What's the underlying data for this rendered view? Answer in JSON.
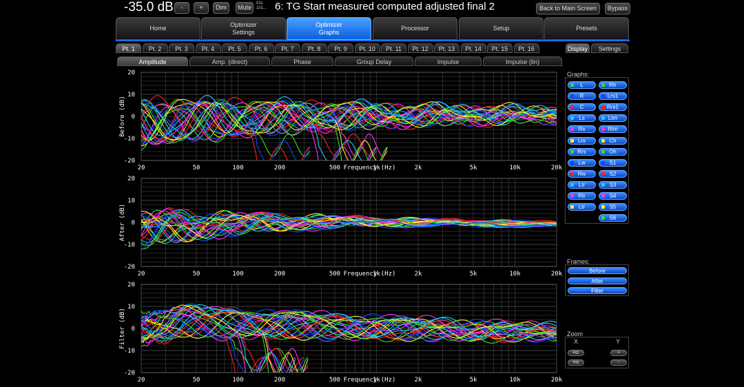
{
  "top": {
    "volume": "-35.0 dB",
    "minus": "-",
    "plus": "+",
    "dim": "Dim",
    "mute": "Mute",
    "format_line1": "011",
    "format_line2": "101...",
    "preset_title": "6: TG Start measured computed adjusted final 2",
    "back": "Back to Main Screen",
    "bypass": "Bypass"
  },
  "main_tabs": [
    {
      "l1": "Home",
      "l2": ""
    },
    {
      "l1": "Optimizer",
      "l2": "Settings"
    },
    {
      "l1": "Optimizer",
      "l2": "Graphs"
    },
    {
      "l1": "Processor",
      "l2": ""
    },
    {
      "l1": "Setup",
      "l2": ""
    },
    {
      "l1": "Presets",
      "l2": ""
    }
  ],
  "point_tabs": [
    "Pt. 1",
    "Pt. 2",
    "Pt. 3",
    "Pt. 4",
    "Pt. 5",
    "Pt. 6",
    "Pt. 7",
    "Pt. 8",
    "Pt. 9",
    "Pt. 10",
    "Pt. 11",
    "Pt. 12",
    "Pt. 13",
    "Pt. 14",
    "Pt. 15",
    "Pt. 16"
  ],
  "right_tabs": {
    "display": "Display",
    "settings": "Settings"
  },
  "graph_tabs": [
    "Amplitude",
    "Amp. (direct)",
    "Phase",
    "Group Delay",
    "Impulse",
    "Impulse (lin)"
  ],
  "sidebar": {
    "graphs_label": "Graphs:",
    "channels_left": [
      {
        "label": "L",
        "color": "#33dd33"
      },
      {
        "label": "R",
        "color": "#1144ff"
      },
      {
        "label": "C",
        "color": "#ff2222"
      },
      {
        "label": "Ls",
        "color": "#22ccff"
      },
      {
        "label": "Rs",
        "color": "#ff33ff"
      },
      {
        "label": "Lrs",
        "color": "#ffee22"
      },
      {
        "label": "Rrs",
        "color": "#33dd33"
      },
      {
        "label": "Lw",
        "color": "#1144ff"
      },
      {
        "label": "Rw",
        "color": "#ff2222"
      },
      {
        "label": "Ltr",
        "color": "#22ccff"
      },
      {
        "label": "Rtr",
        "color": "#ff33ff"
      },
      {
        "label": "Ltr",
        "color": "#ffee22"
      }
    ],
    "channels_right": [
      {
        "label": "Rtr",
        "color": "#33dd33"
      },
      {
        "label": "Lrs1",
        "color": "#1144ff"
      },
      {
        "label": "Rrs1",
        "color": "#ff2222"
      },
      {
        "label": "Ltm",
        "color": "#22ccff"
      },
      {
        "label": "Rtm",
        "color": "#ff33ff"
      },
      {
        "label": "Ch",
        "color": "#ffee22"
      },
      {
        "label": "Oh",
        "color": "#33dd33"
      },
      {
        "label": "S1",
        "color": "#1144ff"
      },
      {
        "label": "S2",
        "color": "#ff2222"
      },
      {
        "label": "S3",
        "color": "#22ccff"
      },
      {
        "label": "S4",
        "color": "#ff33ff"
      },
      {
        "label": "S5",
        "color": "#ffee22"
      },
      {
        "label": "S6",
        "color": "#33dd33"
      }
    ],
    "frames_label": "Frames:",
    "frames": [
      "Before",
      "After",
      "Filter"
    ],
    "zoom_label": "Zoom",
    "zoom_x": "X",
    "zoom_y": "Y",
    "zoom_hz": "Hz",
    "zoom_ms": "ms",
    "zoom_plus": "+",
    "zoom_minus": "-"
  },
  "chart_data": [
    {
      "type": "line",
      "ylabel": "Before (dB)",
      "xlabel": "Frequency (Hz)",
      "ylim": [
        -20,
        20
      ],
      "xlim": [
        20,
        20000
      ],
      "xscale": "log",
      "x_ticks": [
        "20",
        "50",
        "100",
        "200",
        "500",
        "1k",
        "2k",
        "5k",
        "10k",
        "20k"
      ],
      "y_ticks": [
        "20",
        "10",
        "0",
        "-10",
        "-20"
      ],
      "series_colors": [
        "#33dd33",
        "#1144ff",
        "#ff2222",
        "#22ccff",
        "#ff33ff",
        "#ffee22"
      ],
      "grid": true,
      "style": "before"
    },
    {
      "type": "line",
      "ylabel": "After (dB)",
      "xlabel": "Frequency (Hz)",
      "ylim": [
        -20,
        20
      ],
      "xlim": [
        20,
        20000
      ],
      "xscale": "log",
      "x_ticks": [
        "20",
        "50",
        "100",
        "200",
        "500",
        "1k",
        "2k",
        "5k",
        "10k",
        "20k"
      ],
      "y_ticks": [
        "20",
        "10",
        "0",
        "-10",
        "-20"
      ],
      "series_colors": [
        "#33dd33",
        "#1144ff",
        "#ff2222",
        "#22ccff",
        "#ff33ff",
        "#ffee22"
      ],
      "grid": true,
      "style": "after"
    },
    {
      "type": "line",
      "ylabel": "Filter (dB)",
      "xlabel": "Frequency (Hz)",
      "ylim": [
        -20,
        20
      ],
      "xlim": [
        20,
        20000
      ],
      "xscale": "log",
      "x_ticks": [
        "20",
        "50",
        "100",
        "200",
        "500",
        "1k",
        "2k",
        "5k",
        "10k",
        "20k"
      ],
      "y_ticks": [
        "20",
        "10",
        "0",
        "-10",
        "-20"
      ],
      "series_colors": [
        "#33dd33",
        "#1144ff",
        "#ff2222",
        "#22ccff",
        "#ff33ff",
        "#ffee22"
      ],
      "grid": true,
      "style": "filter"
    }
  ]
}
